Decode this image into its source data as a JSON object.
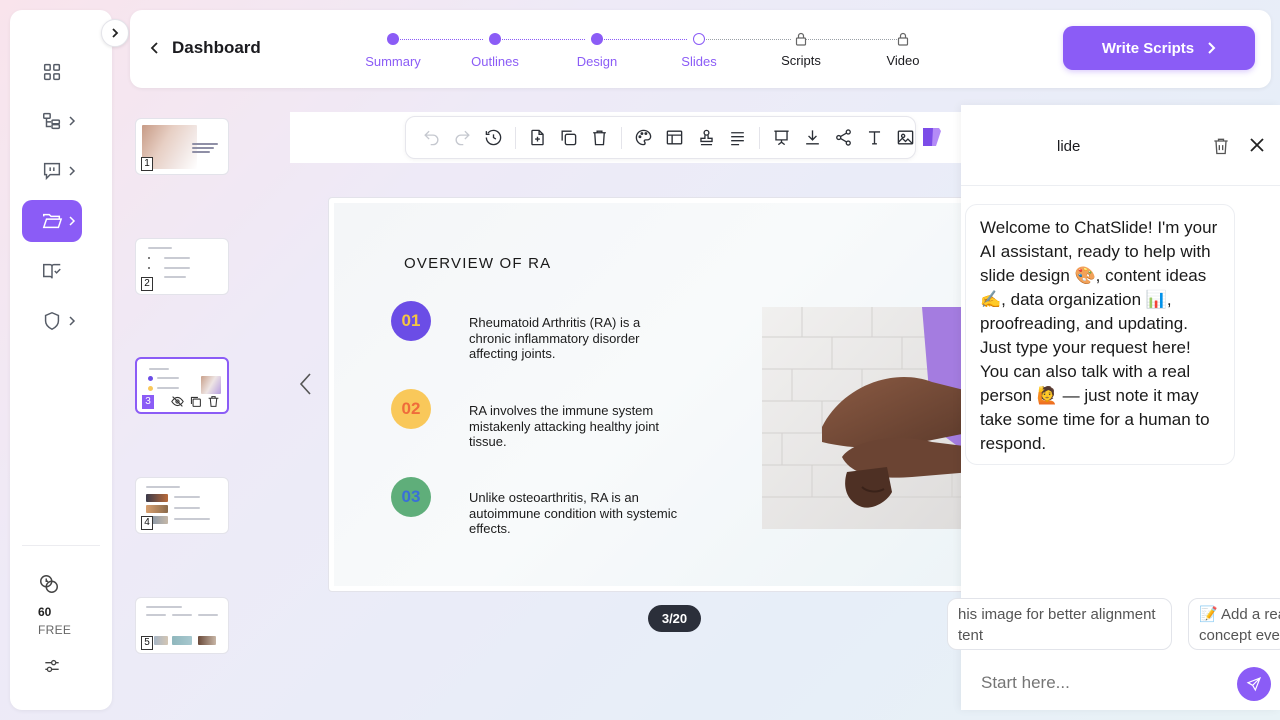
{
  "header": {
    "back_label": "Dashboard",
    "steps": [
      {
        "label": "Summary",
        "state": "done"
      },
      {
        "label": "Outlines",
        "state": "done"
      },
      {
        "label": "Design",
        "state": "done"
      },
      {
        "label": "Slides",
        "state": "current"
      },
      {
        "label": "Scripts",
        "state": "locked"
      },
      {
        "label": "Video",
        "state": "locked"
      }
    ],
    "primary_button": "Write Scripts"
  },
  "sidebar": {
    "items": [
      {
        "icon": "dashboard-grid-icon"
      },
      {
        "icon": "workflow-icon"
      },
      {
        "icon": "chat-board-icon"
      },
      {
        "icon": "folder-icon",
        "active": true
      },
      {
        "icon": "book-check-icon"
      },
      {
        "icon": "shield-icon"
      }
    ],
    "credits": "60",
    "plan": "FREE"
  },
  "thumbnails": [
    {
      "number": "1"
    },
    {
      "number": "2"
    },
    {
      "number": "3",
      "active": true
    },
    {
      "number": "4"
    },
    {
      "number": "5"
    }
  ],
  "toolbar": {
    "tools": [
      "undo-icon",
      "redo-icon",
      "history-icon",
      "add-page-icon",
      "duplicate-icon",
      "delete-icon",
      "palette-icon",
      "layout-icon",
      "stamp-icon",
      "align-icon",
      "present-icon",
      "download-icon",
      "share-icon",
      "text-icon",
      "image-icon"
    ]
  },
  "slide": {
    "title": "OVERVIEW OF RA",
    "bullets": [
      {
        "num": "01",
        "color": "#6b4de6",
        "text_color": "#f4c542",
        "text": "Rheumatoid Arthritis (RA) is a chronic inflammatory disorder affecting joints."
      },
      {
        "num": "02",
        "color": "#f9c85a",
        "text_color": "#ef6c3b",
        "text": "RA involves the immune system mistakenly attacking healthy joint tissue."
      },
      {
        "num": "03",
        "color": "#5fae7a",
        "text_color": "#3a6fd8",
        "text": "Unlike osteoarthritis, RA is an autoimmune condition with systemic effects."
      }
    ],
    "page_indicator": "3/20"
  },
  "chat": {
    "title": "lide",
    "message": "Welcome to ChatSlide! I'm your AI assistant, ready to help with slide design 🎨, content ideas ✍️, data organization 📊, proofreading, and updating. Just type your request here! You can also talk with a real person 🙋 — just note it may take some time for a human to respond.",
    "suggestions": [
      {
        "line1": "his image for better alignment",
        "line2": "tent"
      },
      {
        "line1": "📝 Add a rea",
        "line2": "concept eve"
      }
    ],
    "input_placeholder": "Start here..."
  },
  "colors": {
    "accent": "#8b5cf6",
    "dark": "#2b2f3a"
  }
}
